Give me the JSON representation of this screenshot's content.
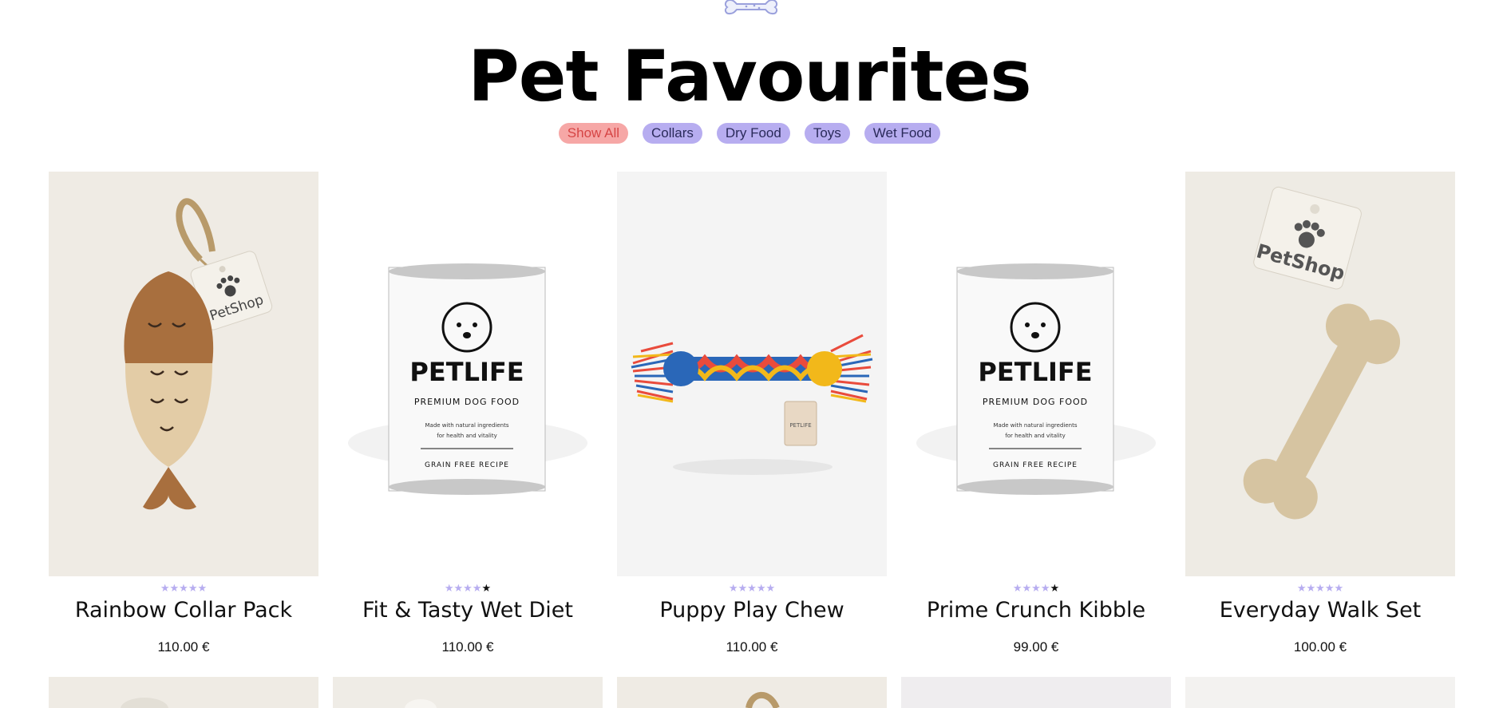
{
  "page": {
    "title": "Pet Favourites"
  },
  "filters": [
    {
      "label": "Show All",
      "active": true
    },
    {
      "label": "Collars",
      "active": false
    },
    {
      "label": "Dry Food",
      "active": false
    },
    {
      "label": "Toys",
      "active": false
    },
    {
      "label": "Wet Food",
      "active": false
    }
  ],
  "products": [
    {
      "name": "Rainbow Collar Pack",
      "price": "110.00 €",
      "rating": 5,
      "image": "fish-toy",
      "tag_text": "PetShop"
    },
    {
      "name": "Fit & Tasty Wet Diet",
      "price": "110.00 €",
      "rating": 4,
      "image": "dog-food-can",
      "can": {
        "brand": "PETLIFE",
        "subtitle": "PREMIUM DOG FOOD",
        "desc1": "Made with natural ingredients",
        "desc2": "for health and vitality",
        "recipe": "GRAIN FREE RECIPE"
      }
    },
    {
      "name": "Puppy Play Chew",
      "price": "110.00 €",
      "rating": 5,
      "image": "rope-toy",
      "tag_text": "PETLIFE"
    },
    {
      "name": "Prime Crunch Kibble",
      "price": "99.00 €",
      "rating": 4,
      "image": "dog-food-can",
      "can": {
        "brand": "PETLIFE",
        "subtitle": "PREMIUM DOG FOOD",
        "desc1": "Made with natural ingredients",
        "desc2": "for health and vitality",
        "recipe": "GRAIN FREE RECIPE"
      }
    },
    {
      "name": "Everyday Walk Set",
      "price": "100.00 €",
      "rating": 5,
      "image": "bone-toy",
      "tag_text": "PetShop"
    }
  ],
  "colors": {
    "accent": "#b7adf0",
    "active_pill_bg": "#f6a7a6",
    "active_pill_text": "#d64545"
  }
}
